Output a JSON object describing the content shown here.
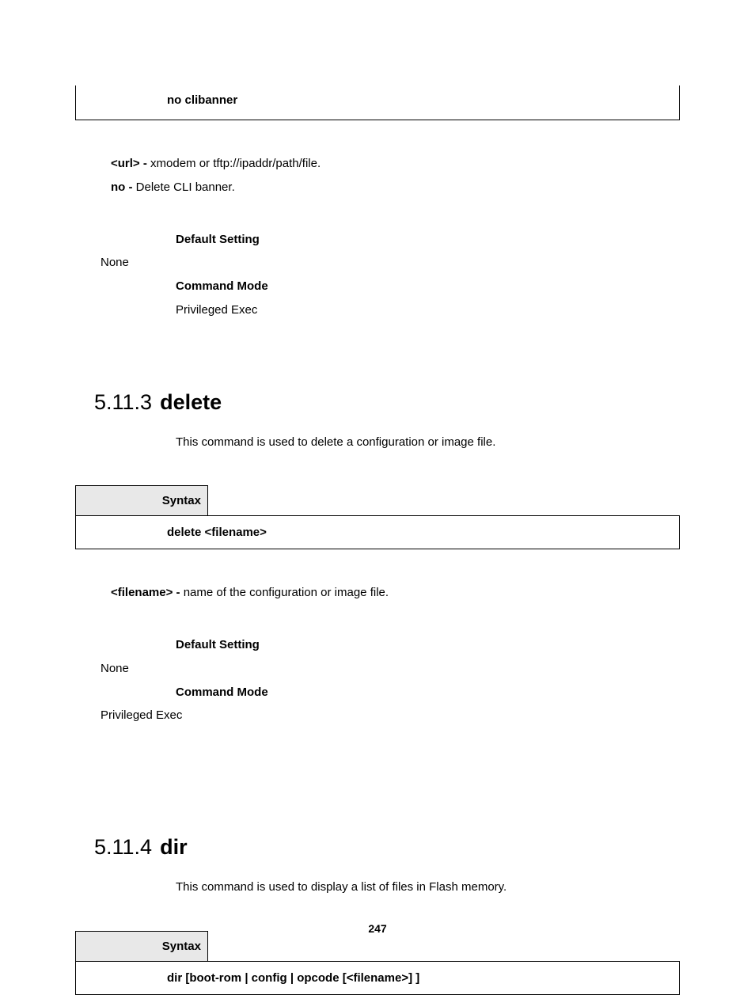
{
  "top_box": {
    "line": "no clibanner"
  },
  "urlparam": {
    "label": "<url> - ",
    "desc": "xmodem or tftp://ipaddr/path/file."
  },
  "noparam": {
    "label": "no - ",
    "desc": "Delete CLI banner."
  },
  "labels": {
    "default_setting": "Default Setting",
    "command_mode": "Command Mode",
    "syntax": "Syntax"
  },
  "values": {
    "none": "None",
    "priv_exec": "Privileged Exec"
  },
  "sec_delete": {
    "num": "5.11.3",
    "name": "delete",
    "desc": "This command is used to delete a configuration or image file.",
    "syntax_body": "delete <filename>",
    "param_label": "<filename> - ",
    "param_desc": "name of the configuration or image file."
  },
  "sec_dir": {
    "num": "5.11.4",
    "name": "dir",
    "desc": "This command is used to display a list of files in Flash memory.",
    "syntax_body": "dir [boot-rom | config | opcode [<filename>] ]"
  },
  "page_number": "247"
}
